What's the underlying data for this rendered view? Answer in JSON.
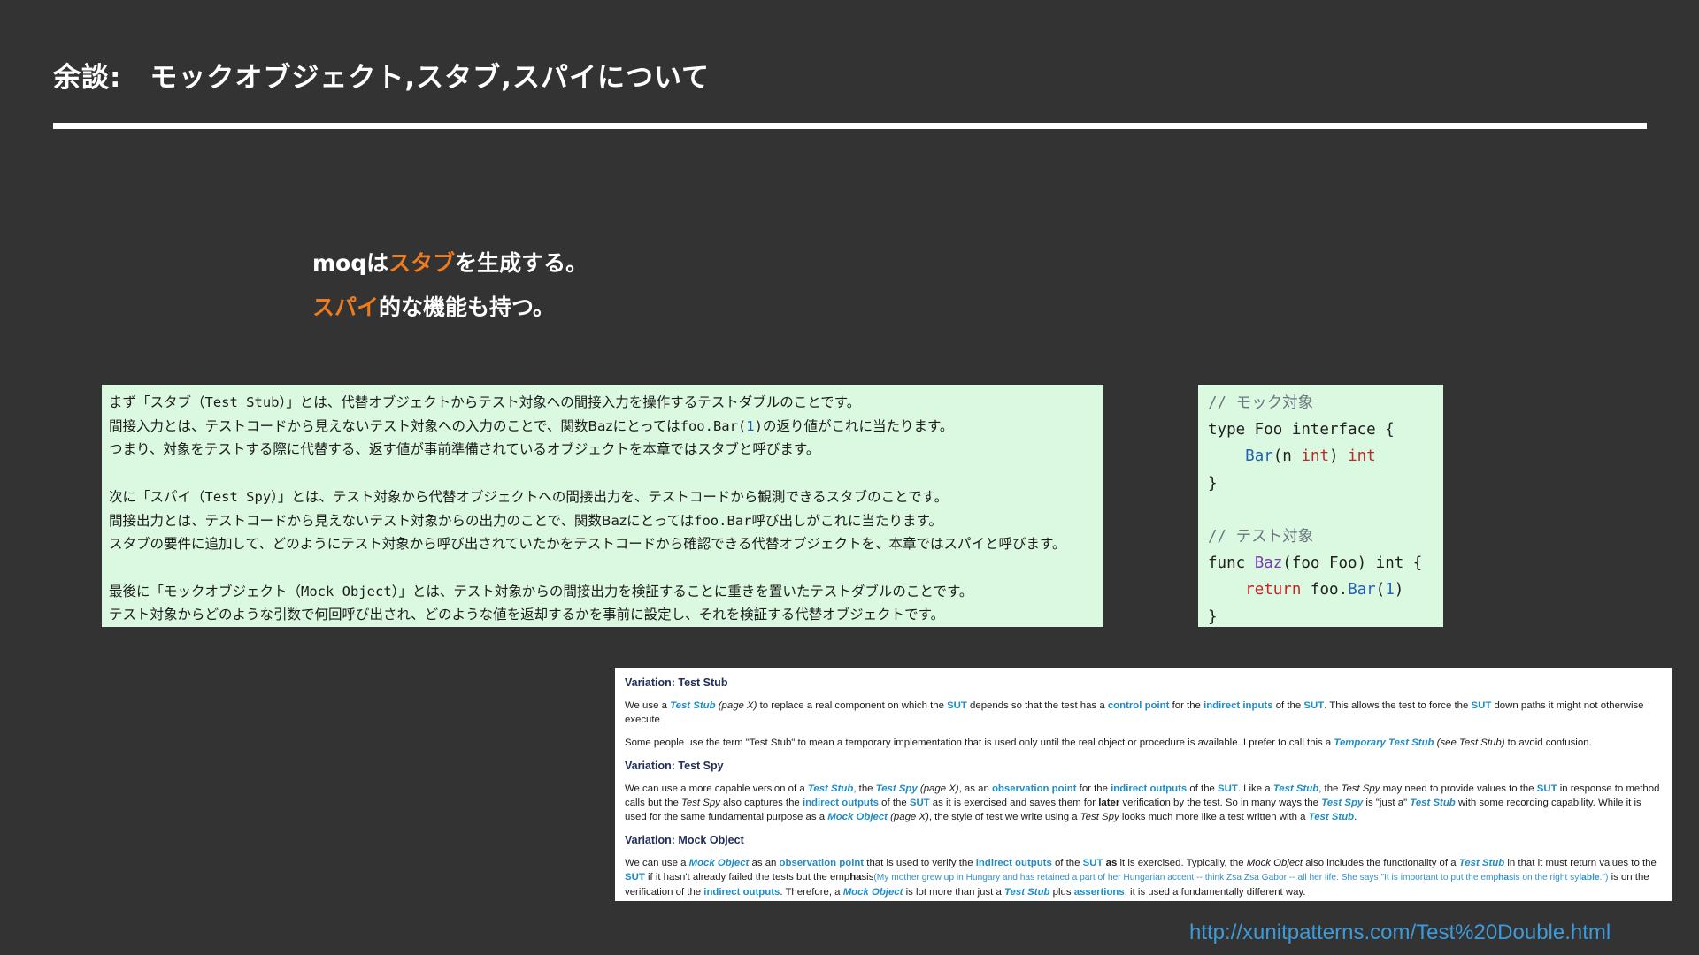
{
  "slide": {
    "title_prefix": "余談:",
    "title_main": "モックオブジェクト,スタブ,スパイについて"
  },
  "lead": {
    "line1": {
      "pre": "moqは",
      "accent": "スタブ",
      "post": "を生成する。"
    },
    "line2": {
      "accent": "スパイ",
      "post": "的な機能も持つ。"
    }
  },
  "jp_definitions": {
    "stub": {
      "l1": {
        "a": "まず「スタブ（",
        "m": "Test Stub",
        "b": "）」とは、代替オブジェクトからテスト対象への間接入力を操作するテストダブルのことです。"
      },
      "l2": {
        "a": "間接入力とは、テストコードから見えないテスト対象への入力のことで、関数Bazにとっては",
        "m1": "foo.Bar(",
        "num": "1",
        "m2": ")",
        "b": "の返り値がこれに当たります。"
      },
      "l3": "つまり、対象をテストする際に代替する、返す値が事前準備されているオブジェクトを本章ではスタブと呼びます。"
    },
    "spy": {
      "l1": {
        "a": "次に「スパイ（",
        "m": "Test Spy",
        "b": "）」とは、テスト対象から代替オブジェクトへの間接出力を、テストコードから観測できるスタブのことです。"
      },
      "l2": {
        "a": "間接出力とは、テストコードから見えないテスト対象からの出力のことで、関数Bazにとっては",
        "m": "foo.Bar",
        "b": "呼び出しがこれに当たります。"
      },
      "l3": "スタブの要件に追加して、どのようにテスト対象から呼び出されていたかをテストコードから確認できる代替オブジェクトを、本章ではスパイと呼びます。"
    },
    "mock": {
      "l1": {
        "a": "最後に「モックオブジェクト（",
        "m": "Mock Object",
        "b": "）」とは、テスト対象からの間接出力を検証することに重きを置いたテストダブルのことです。"
      },
      "l2": "テスト対象からどのような引数で何回呼び出され、どのような値を返却するかを事前に設定し、それを検証する代替オブジェクトです。"
    }
  },
  "code": {
    "comment1": "// モック対象",
    "l2": "type Foo interface {",
    "l3_fn": "Bar",
    "l3_a": "(n ",
    "l3_kw1": "int",
    "l3_b": ") ",
    "l3_kw2": "int",
    "l4": "}",
    "comment2": "// テスト対象",
    "l6_a": "func ",
    "l6_fn": "Baz",
    "l6_b": "(foo Foo) int {",
    "l7_kw": "return",
    "l7_a": " foo.",
    "l7_fn": "Bar",
    "l7_b": "(",
    "l7_num": "1",
    "l7_c": ")",
    "l8": "}"
  },
  "xunit": {
    "stub_heading": "Variation: Test Stub",
    "stub_p1": [
      "We use a ",
      "Test Stub",
      " (page X)",
      " to replace a real component on which the ",
      "SUT",
      " depends so that the test has a ",
      "control point",
      " for the ",
      "indirect inputs",
      " of the ",
      "SUT",
      ". This allows the test to force the ",
      "SUT",
      " down paths it might not otherwise execute"
    ],
    "stub_p2": [
      "Some people use the term \"Test Stub\" to mean a temporary implementation that is used only until the real object or procedure is available. I prefer to call this a ",
      "Temporary Test Stub",
      " (see Test Stub)",
      " to avoid confusion."
    ],
    "spy_heading": "Variation: Test Spy",
    "spy_p": [
      "We can use a more capable version of a ",
      "Test Stub",
      ", the ",
      "Test Spy",
      " (page X)",
      ", as an ",
      "observation point",
      " for the ",
      "indirect outputs",
      " of the ",
      "SUT",
      ". Like a ",
      "Test Stub",
      ", the ",
      "Test Spy",
      " may need to provide values to the ",
      "SUT",
      " in response to method calls but the ",
      "Test Spy",
      " also captures the ",
      "indirect outputs",
      " of the ",
      "SUT",
      " as it is exercised and saves them for ",
      "later",
      " verification by the test. So in many ways the ",
      "Test Spy",
      " is \"just a\" ",
      "Test Stub",
      " with some recording capability. While it is used for the same fundamental purpose as a ",
      "Mock Object",
      " (page X)",
      ", the style of test we write using a ",
      "Test Spy",
      " looks much more like a test written with a ",
      "Test Stub",
      "."
    ],
    "mock_heading": "Variation: Mock Object",
    "mock_p": [
      "We can use a ",
      "Mock Object",
      " as an ",
      "observation point",
      " that is used to verify the ",
      "indirect outputs",
      " of the ",
      "SUT",
      " ",
      "as",
      " it is exercised. Typically, the ",
      "Mock Object",
      " also includes the functionality of a ",
      "Test Stub",
      " in that it must return values to the ",
      "SUT",
      " if it hasn't already failed the tests but the emp",
      "ha",
      "sis",
      "(My mother grew up in Hungary and has retained a part of her Hungarian accent -- think Zsa Zsa Gabor -- all her life. She says \"It is important to put the emp",
      "ha",
      "sis on the right sy",
      "lable",
      ".\")",
      " is on the verification of the ",
      "indirect outputs",
      ". Therefore, a ",
      "Mock Object",
      " is lot more than just a ",
      "Test Stub",
      " plus ",
      "assertions",
      "; it is used a fundamentally different way."
    ]
  },
  "source_url": "http://xunitpatterns.com/Test%20Double.html",
  "colors": {
    "background": "#333333",
    "accent_orange": "#f07b1d",
    "panel_green": "#dbf9e0",
    "link_blue": "#1f8bc7",
    "url_blue": "#3f9ad8"
  }
}
